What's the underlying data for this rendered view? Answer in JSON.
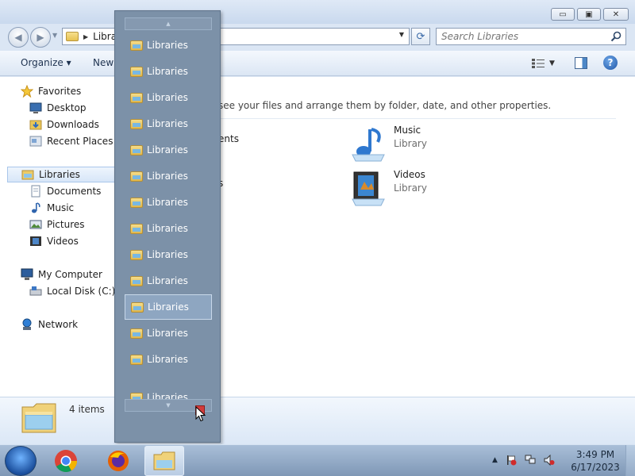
{
  "window": {
    "caption": {
      "minimize": "▭",
      "maximize": "▣",
      "close": "✕"
    }
  },
  "address": {
    "path": "Libra",
    "search_placeholder": "Search Libraries"
  },
  "toolbar": {
    "organize": "Organize ▾",
    "new": "New"
  },
  "nav": {
    "favorites": "Favorites",
    "desktop": "Desktop",
    "downloads": "Downloads",
    "recent": "Recent Places",
    "libraries": "Libraries",
    "documents": "Documents",
    "music": "Music",
    "pictures": "Pictures",
    "videos": "Videos",
    "computer": "My Computer",
    "local_disk": "Local Disk (C:)",
    "network": "Network"
  },
  "content": {
    "description": "see your files and arrange them by folder, date, and other properties.",
    "partial_1": "ents",
    "partial_2": "s",
    "libraries": [
      {
        "name": "Music",
        "type": "Library"
      },
      {
        "name": "Videos",
        "type": "Library"
      }
    ]
  },
  "details": {
    "count": "4 items"
  },
  "dropdown": {
    "items": [
      "Libraries",
      "Libraries",
      "Libraries",
      "Libraries",
      "Libraries",
      "Libraries",
      "Libraries",
      "Libraries",
      "Libraries",
      "Libraries",
      "Libraries",
      "Libraries",
      "Libraries",
      "Libraries"
    ],
    "selected_index": 10
  },
  "taskbar": {
    "time": "3:49 PM",
    "date": "6/17/2023"
  }
}
